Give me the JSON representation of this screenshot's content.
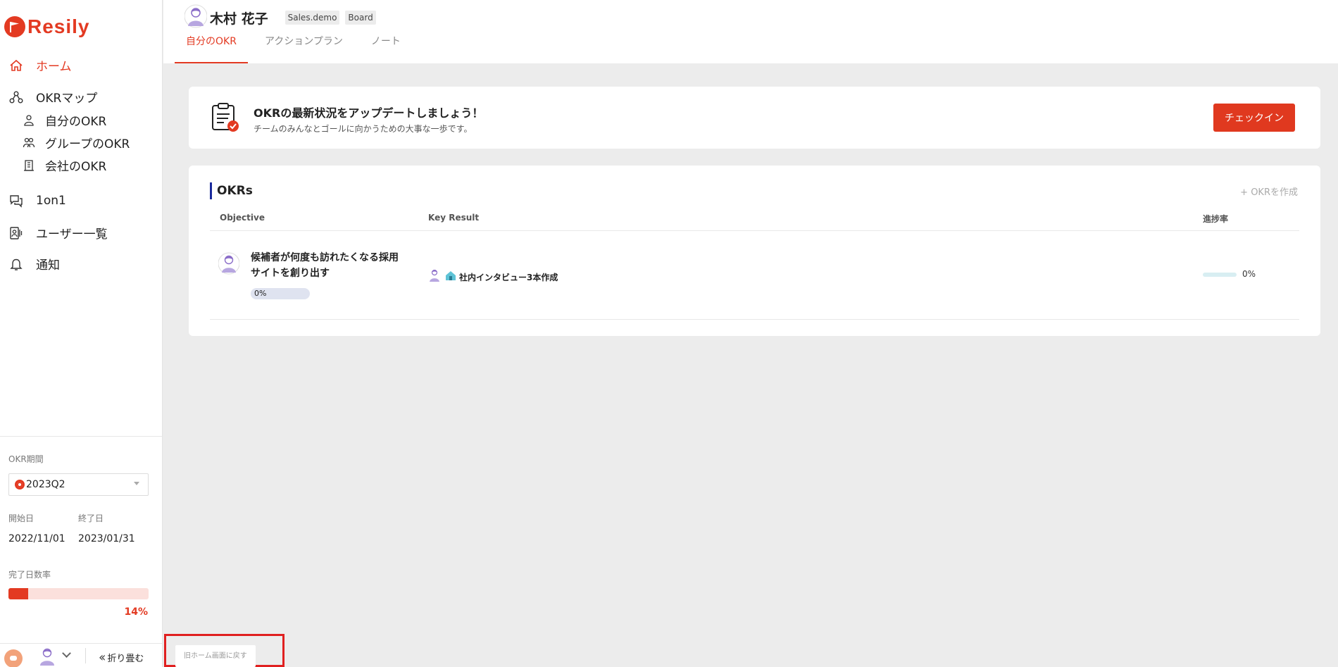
{
  "brand": {
    "name": "Resily",
    "color": "#e33a22"
  },
  "sidebar": {
    "nav": [
      {
        "label": "ホーム",
        "icon": "home-icon",
        "active": true
      },
      {
        "label": "OKRマップ",
        "icon": "map-icon"
      },
      {
        "label": "自分のOKR",
        "icon": "person-icon"
      },
      {
        "label": "グループのOKR",
        "icon": "group-icon"
      },
      {
        "label": "会社のOKR",
        "icon": "building-icon"
      },
      {
        "label": "1on1",
        "icon": "chat-icon"
      },
      {
        "label": "ユーザー一覧",
        "icon": "users-icon"
      },
      {
        "label": "通知",
        "icon": "bell-icon"
      }
    ],
    "period_label": "OKR期間",
    "period_value": "2023Q2",
    "start_label": "開始日",
    "end_label": "終了日",
    "start_date": "2022/11/01",
    "end_date": "2023/01/31",
    "completion_label": "完了日数率",
    "completion_pct": "14%",
    "completion_fraction": 0.14,
    "collapse_label": "折り畳む"
  },
  "header": {
    "user_name": "木村 花子",
    "tags": [
      "Sales.demo",
      "Board"
    ],
    "tabs": [
      "自分のOKR",
      "アクションプラン",
      "ノート"
    ]
  },
  "checkin": {
    "title": "OKRの最新状況をアップデートしましょう！",
    "subtitle": "チームのみんなとゴールに向かうための大事な一歩です。",
    "button": "チェックイン"
  },
  "okrs": {
    "heading": "OKRs",
    "create_label": "+ OKRを作成",
    "columns": [
      "Objective",
      "Key Result",
      "進捗率"
    ],
    "objective": {
      "title": "候補者が何度も訪れたくなる採用サイトを創り出す",
      "progress": "0%"
    },
    "key_result": {
      "title": "社内インタビュー3本作成",
      "progress": "0%",
      "fraction": 0
    }
  },
  "back_button": "旧ホーム画面に戻す"
}
